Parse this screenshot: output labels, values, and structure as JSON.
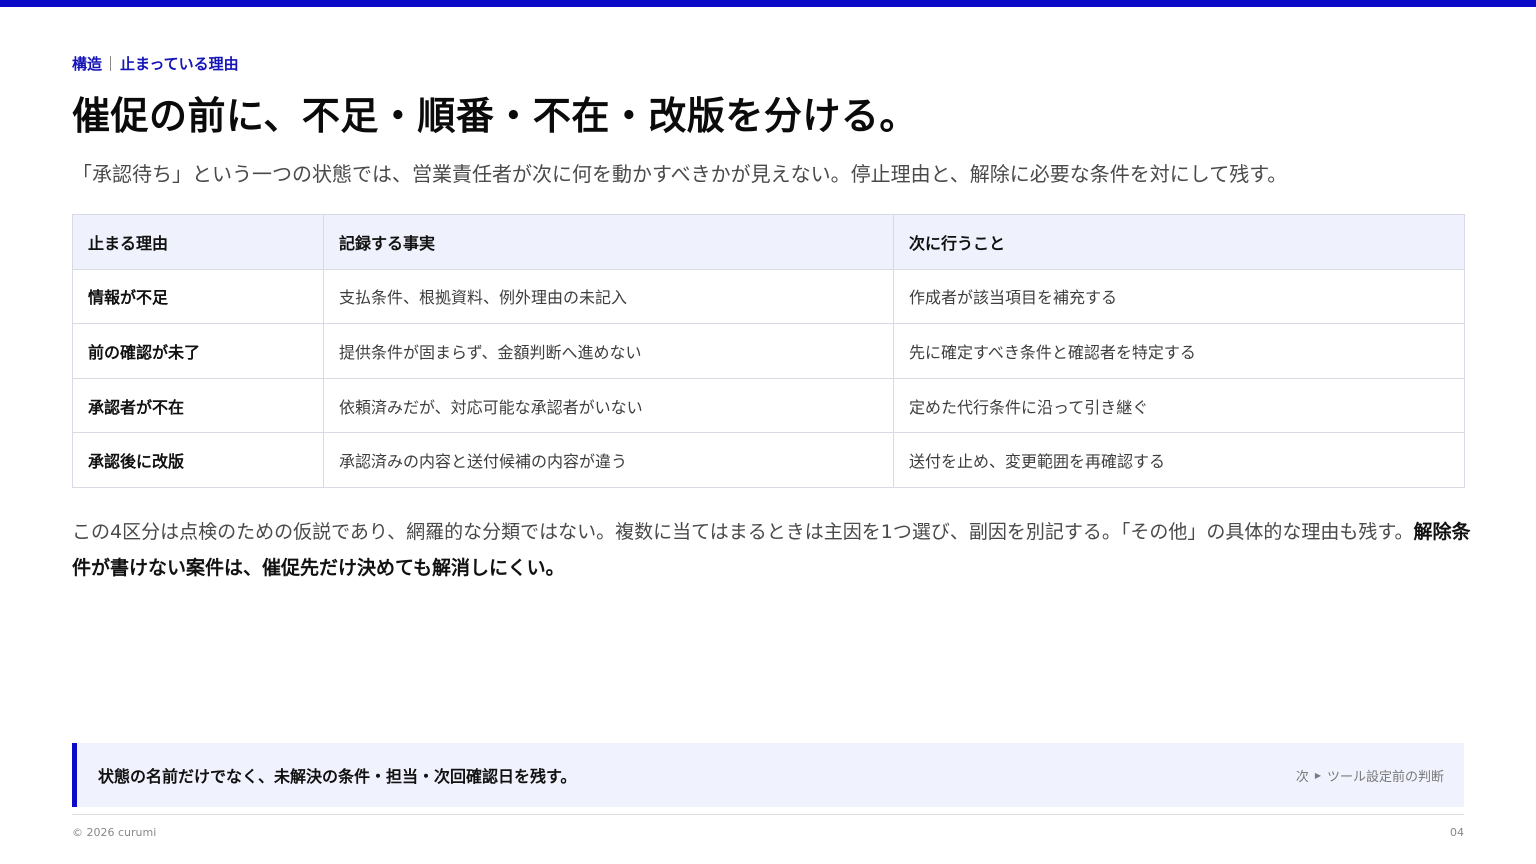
{
  "colors": {
    "accent": "#0a0ac8",
    "header_bg": "#eff2fd"
  },
  "eyebrow": {
    "section": "構造",
    "topic": "止まっている理由"
  },
  "title": "催促の前に、不足・順番・不在・改版を分ける。",
  "lead": "「承認待ち」という一つの状態では、営業責任者が次に何を動かすべきかが見えない。停止理由と、解除に必要な条件を対にして残す。",
  "table": {
    "headers": [
      "止まる理由",
      "記録する事実",
      "次に行うこと"
    ],
    "rows": [
      [
        "情報が不足",
        "支払条件、根拠資料、例外理由の未記入",
        "作成者が該当項目を補充する"
      ],
      [
        "前の確認が未了",
        "提供条件が固まらず、金額判断へ進めない",
        "先に確定すべき条件と確認者を特定する"
      ],
      [
        "承認者が不在",
        "依頼済みだが、対応可能な承認者がいない",
        "定めた代行条件に沿って引き継ぐ"
      ],
      [
        "承認後に改版",
        "承認済みの内容と送付候補の内容が違う",
        "送付を止め、変更範囲を再確認する"
      ]
    ]
  },
  "note": {
    "text": "この4区分は点検のための仮説であり、網羅的な分類ではない。複数に当てはまるときは主因を1つ選び、副因を別記する。「その他」の具体的な理由も残す。",
    "emphasis": "解除条件が書けない案件は、催促先だけ決めても解消しにくい。"
  },
  "callout": {
    "text": "状態の名前だけでなく、未解決の条件・担当・次回確認日を残す。",
    "next_prefix": "次",
    "next_label": "ツール設定前の判断",
    "arrow_icon": "triangle-right-icon"
  },
  "footer": {
    "copyright": "© 2026 curumi",
    "page": "04"
  }
}
